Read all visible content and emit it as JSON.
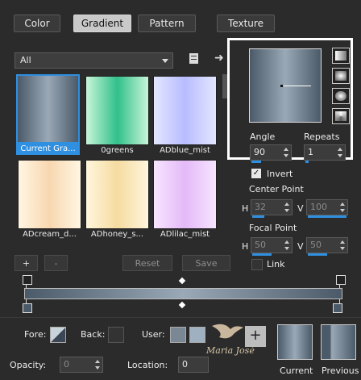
{
  "tabs": [
    {
      "label": "Color",
      "active": false
    },
    {
      "label": "Gradient",
      "active": true
    },
    {
      "label": "Pattern",
      "active": false
    },
    {
      "label": "Texture",
      "active": false
    }
  ],
  "library": {
    "category": "All",
    "items": [
      {
        "label": "Current Gra...",
        "selected": true,
        "colors": [
          "#4b5a68",
          "#9aa9b7",
          "#4b5a68"
        ]
      },
      {
        "label": "0greens",
        "selected": false,
        "colors": [
          "#c8f5d8",
          "#30c08a",
          "#c8f5d8"
        ]
      },
      {
        "label": "ADblue_mist",
        "selected": false,
        "colors": [
          "#e3e6ff",
          "#b8bcff",
          "#e3e6ff"
        ]
      },
      {
        "label": "ADcream_d...",
        "selected": false,
        "colors": [
          "#fff6e2",
          "#f8d7b0",
          "#fff6e2"
        ]
      },
      {
        "label": "ADhoney_s...",
        "selected": false,
        "colors": [
          "#fff6dc",
          "#f5dba0",
          "#fff6dc"
        ]
      },
      {
        "label": "ADlilac_mist",
        "selected": false,
        "colors": [
          "#f7e4ff",
          "#e4b9f8",
          "#f7e4ff"
        ]
      }
    ]
  },
  "buttons": {
    "add": "+",
    "remove": "-",
    "reset": "Reset",
    "save": "Save"
  },
  "preview": {
    "angle_label": "Angle",
    "angle_value": "90",
    "repeats_label": "Repeats",
    "repeats_value": "1",
    "invert_label": "Invert",
    "invert_checked": true
  },
  "center_point": {
    "label": "Center Point",
    "h_label": "H",
    "h_value": "32",
    "v_label": "V",
    "v_value": "100"
  },
  "focal_point": {
    "label": "Focal Point",
    "h_label": "H",
    "h_value": "50",
    "v_label": "V",
    "v_value": "50",
    "link_label": "Link"
  },
  "bottom": {
    "fore_label": "Fore:",
    "back_label": "Back:",
    "user_label": "User:",
    "opacity_label": "Opacity:",
    "opacity_value": "0",
    "location_label": "Location:",
    "location_value": "0",
    "current_label": "Current",
    "previous_label": "Previous",
    "watermark": "Maria José"
  },
  "colors": {
    "accent": "#2f8fe0",
    "gradient_dark": "#4b5a68",
    "gradient_light": "#9aa9b7",
    "highlight_border": "#ffffff"
  }
}
